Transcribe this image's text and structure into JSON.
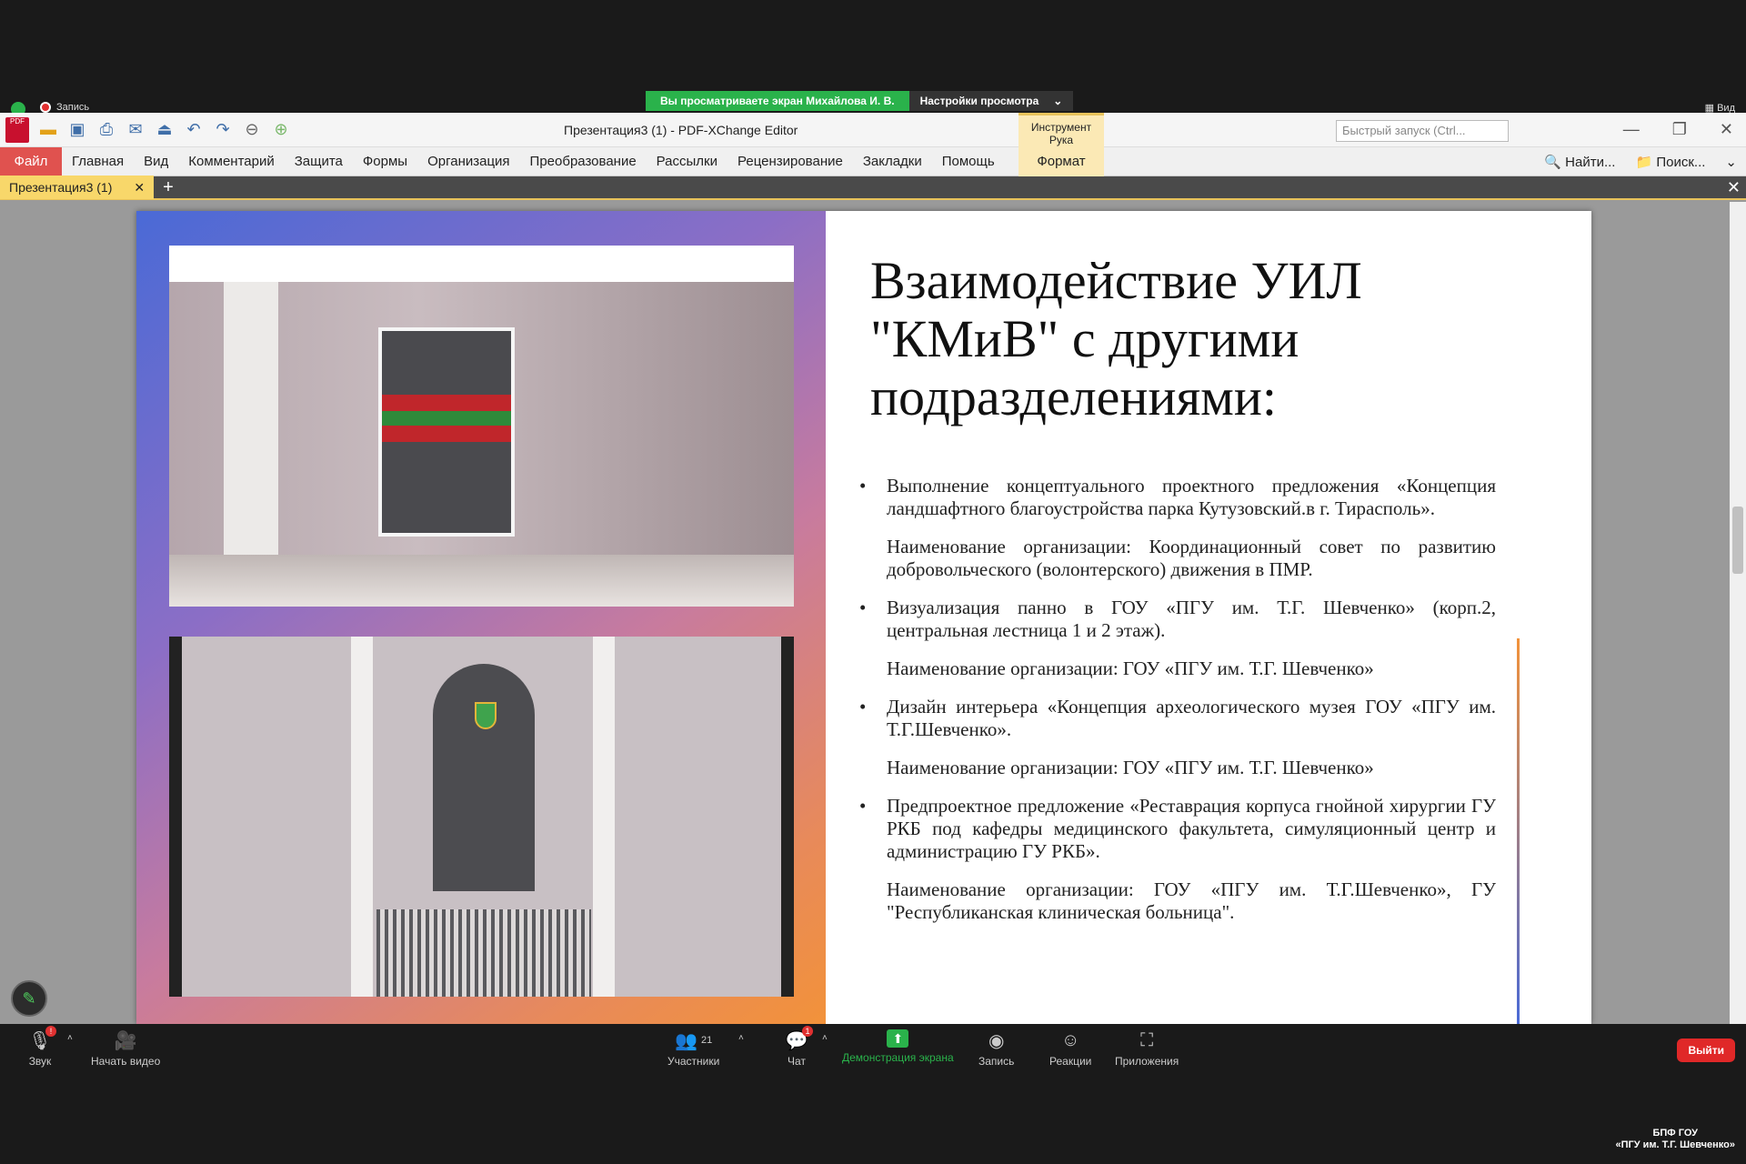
{
  "zoom": {
    "recording_label": "Запись",
    "viewing_banner": "Вы просматриваете экран Михайлова И. В.",
    "view_settings": "Настройки просмотра",
    "view_button": "Вид",
    "toolbar": {
      "audio": "Звук",
      "video": "Начать видео",
      "participants": "Участники",
      "participants_count": "21",
      "chat": "Чат",
      "chat_badge": "1",
      "audio_badge": "!",
      "share": "Демонстрация экрана",
      "record": "Запись",
      "reactions": "Реакции",
      "apps": "Приложения",
      "leave": "Выйти"
    },
    "watermark_line1": "БПФ ГОУ",
    "watermark_line2": "«ПГУ им. Т.Г. Шевченко»"
  },
  "app": {
    "title": "Презентация3 (1) - PDF-XChange Editor",
    "logo_text": "PDF",
    "tool_tab": "Инструмент Рука",
    "quicklaunch_placeholder": "Быстрый запуск (Ctrl...",
    "menu": {
      "file": "Файл",
      "items": [
        "Главная",
        "Вид",
        "Комментарий",
        "Защита",
        "Формы",
        "Организация",
        "Преобразование",
        "Рассылки",
        "Рецензирование",
        "Закладки",
        "Помощь"
      ],
      "format": "Формат",
      "find": "Найти...",
      "search": "Поиск..."
    },
    "tab": "Презентация3 (1)"
  },
  "slide": {
    "title": "Взаимодействие УИЛ \"КМиВ\" с другими подразделениями:",
    "bullets": [
      {
        "text": "Выполнение концептуального проектного предложения «Концепция ландшафтного благоустройства парка Кутузовский.в г. Тирасполь».",
        "org": "Наименование организации: Координационный совет по развитию добровольческого (волонтерского) движения в ПМР."
      },
      {
        "text": "Визуализация панно в ГОУ «ПГУ им. Т.Г. Шевченко» (корп.2, центральная лестница 1 и 2 этаж).",
        "org": "Наименование организации: ГОУ «ПГУ им. Т.Г. Шевченко»"
      },
      {
        "text": "Дизайн интерьера «Концепция археологического музея ГОУ «ПГУ им. Т.Г.Шевченко».",
        "org": "Наименование организации: ГОУ «ПГУ им. Т.Г. Шевченко»"
      },
      {
        "text": "Предпроектное предложение «Реставрация корпуса гнойной хирургии ГУ РКБ под кафедры медицинского факультета, симуляционный центр и администрацию ГУ РКБ».",
        "org": "Наименование организации: ГОУ «ПГУ им. Т.Г.Шевченко», ГУ \"Республиканская клиническая больница\"."
      }
    ]
  }
}
